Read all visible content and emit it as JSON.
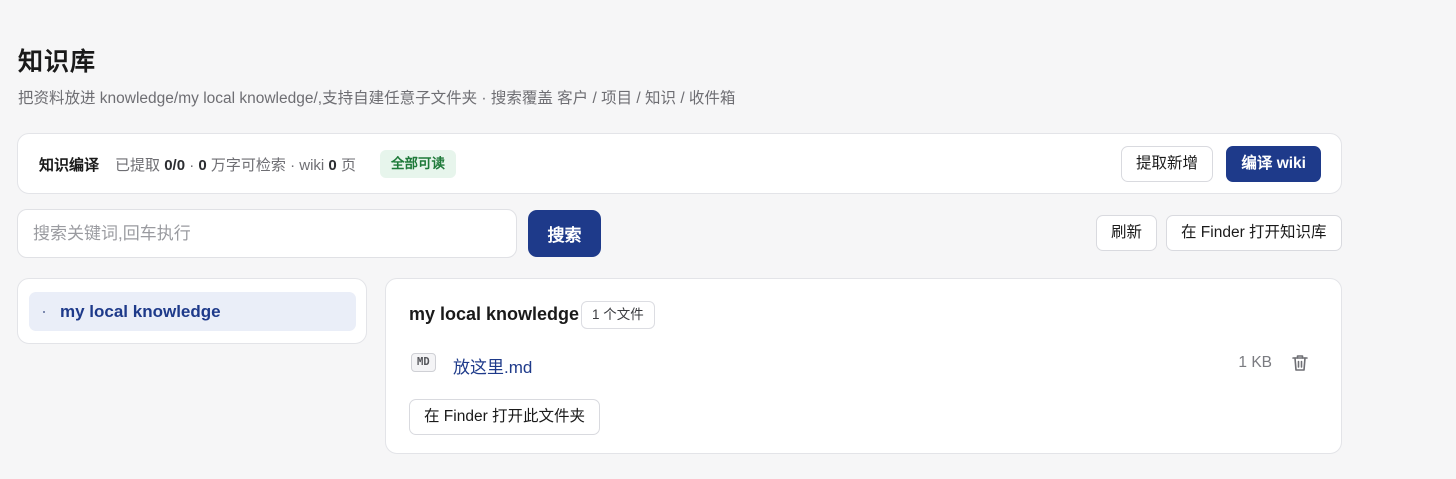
{
  "page": {
    "title": "知识库",
    "subtitle": "把资料放进 knowledge/my local knowledge/,支持自建任意子文件夹 · 搜索覆盖 客户 / 项目 / 知识 / 收件箱"
  },
  "compile": {
    "title": "知识编译",
    "extracted_label": "已提取",
    "extracted_value": "0/0",
    "sep1": "·",
    "chars_value": "0",
    "chars_label": "万字可检索 · wiki",
    "wiki_value": "0",
    "wiki_unit": "页",
    "status_badge": "全部可读",
    "extract_button": "提取新增",
    "compile_button": "编译 wiki"
  },
  "search": {
    "placeholder": "搜索关键词,回车执行",
    "value": "",
    "button": "搜索",
    "refresh_button": "刷新",
    "open_finder_button": "在 Finder 打开知识库"
  },
  "sidebar": {
    "items": [
      {
        "label": "my local knowledge",
        "selected": true
      }
    ]
  },
  "folder": {
    "title": "my local knowledge",
    "file_count": "1 个文件",
    "files": [
      {
        "type_tag": "MD",
        "name": "放这里.md",
        "size": "1 KB"
      }
    ],
    "open_folder_button": "在 Finder 打开此文件夹"
  },
  "colors": {
    "primary": "#1e3a8a",
    "badge_text": "#1f7a3a",
    "badge_bg": "#e7f5ec",
    "selected_bg": "#eaeef8"
  },
  "icons": {
    "delete": "trash-icon"
  }
}
